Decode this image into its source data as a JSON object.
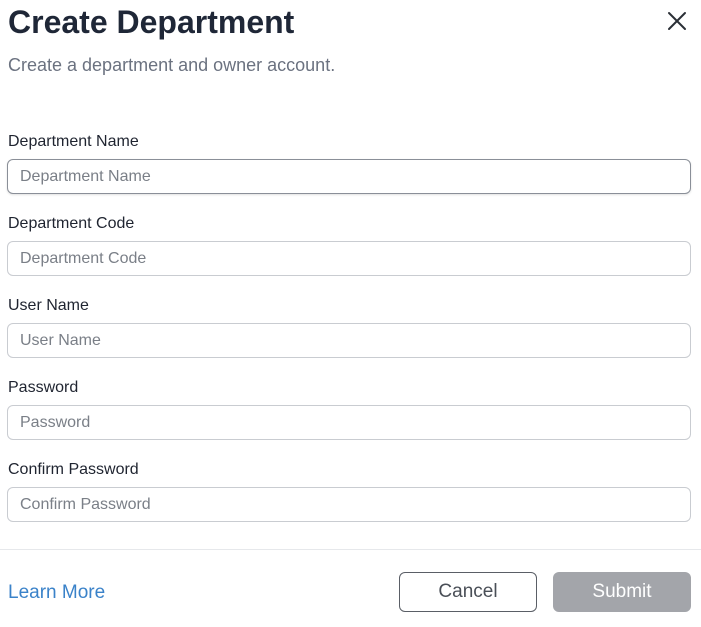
{
  "dialog": {
    "title": "Create Department",
    "subtitle": "Create a department and owner account.",
    "close_icon": "close-icon"
  },
  "form": {
    "fields": [
      {
        "label": "Department Name",
        "placeholder": "Department Name",
        "value": ""
      },
      {
        "label": "Department Code",
        "placeholder": "Department Code",
        "value": ""
      },
      {
        "label": "User Name",
        "placeholder": "User Name",
        "value": ""
      },
      {
        "label": "Password",
        "placeholder": "Password",
        "value": ""
      },
      {
        "label": "Confirm Password",
        "placeholder": "Confirm Password",
        "value": ""
      }
    ]
  },
  "footer": {
    "learn_more": "Learn More",
    "cancel_label": "Cancel",
    "submit_label": "Submit"
  },
  "colors": {
    "link": "#3a82c9",
    "submit_disabled": "#a3a5aa",
    "title": "#1f2737"
  }
}
